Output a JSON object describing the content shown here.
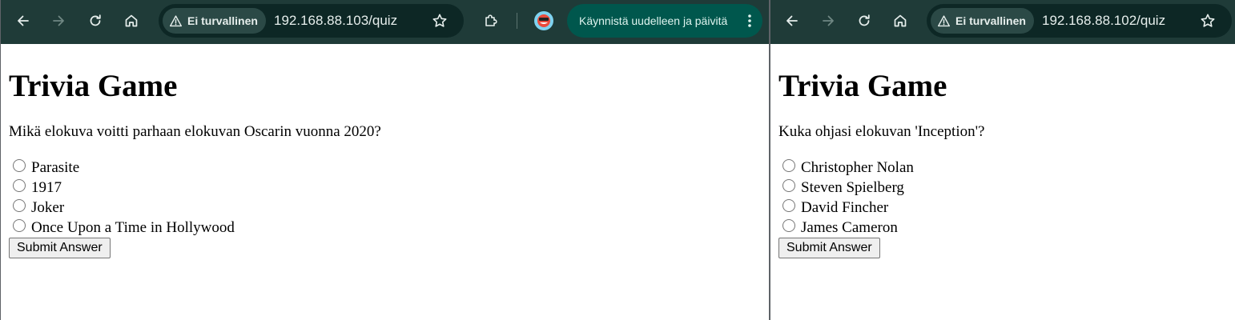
{
  "colors": {
    "toolbar_bg": "#1f3b38",
    "omnibox_bg": "#0d2725",
    "security_chip_bg": "#2b4946",
    "update_pill_bg": "#00574d",
    "icon_color": "#e6eeec",
    "disabled_icon_color": "#6f8783"
  },
  "left": {
    "toolbar": {
      "security_label": "Ei turvallinen",
      "url": "192.168.88.103/quiz",
      "update_label": "Käynnistä uudelleen ja päivitä"
    },
    "page": {
      "title": "Trivia Game",
      "question": "Mikä elokuva voitti parhaan elokuvan Oscarin vuonna 2020?",
      "options": [
        "Parasite",
        "1917",
        "Joker",
        "Once Upon a Time in Hollywood"
      ],
      "submit_label": "Submit Answer"
    }
  },
  "right": {
    "toolbar": {
      "security_label": "Ei turvallinen",
      "url": "192.168.88.102/quiz"
    },
    "page": {
      "title": "Trivia Game",
      "question": "Kuka ohjasi elokuvan 'Inception'?",
      "options": [
        "Christopher Nolan",
        "Steven Spielberg",
        "David Fincher",
        "James Cameron"
      ],
      "submit_label": "Submit Answer"
    }
  },
  "icons": {
    "back": "back-arrow-icon",
    "forward": "forward-arrow-icon",
    "reload": "reload-icon",
    "home": "home-icon",
    "warning": "warning-triangle-icon",
    "bookmark": "star-icon",
    "extensions": "puzzle-icon",
    "profile": "profile-avatar",
    "menu": "kebab-menu-icon"
  }
}
